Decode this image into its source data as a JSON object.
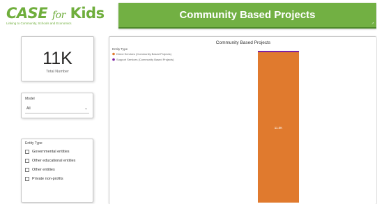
{
  "logo": {
    "main_case": "CASE",
    "main_for": "for",
    "main_kids": "Kids",
    "tagline": "Linking to Community, Schools and Economics"
  },
  "banner": {
    "title": "Community Based Projects",
    "mark": "↗"
  },
  "kpi": {
    "value": "11K",
    "label": "Total Number"
  },
  "model_slicer": {
    "title": "Model",
    "selected": "All",
    "chevron_icon": "chevron-down-icon"
  },
  "entity_slicer": {
    "title": "Entity Type",
    "items": [
      {
        "label": "Governmental entities",
        "checked": false
      },
      {
        "label": "Other educational entities",
        "checked": false
      },
      {
        "label": "Other entities",
        "checked": false
      },
      {
        "label": "Private non-profits",
        "checked": false
      }
    ]
  },
  "colors": {
    "brand_green": "#72b043",
    "orange": "#e07a2e",
    "purple": "#7a1fa2"
  },
  "chart_data": {
    "type": "bar",
    "title": "Community Based Projects",
    "legend_title": "Entity Type",
    "legend_position": "top-left",
    "categories": [
      ""
    ],
    "series": [
      {
        "name": "Direct Services (Community Based Projects)",
        "values": [
          11000
        ],
        "data_label": "11.0K",
        "color": "#e07a2e"
      },
      {
        "name": "Support Services (Community Based Projects)",
        "values": [
          100
        ],
        "data_label": "",
        "color": "#7a1fa2"
      }
    ],
    "stacked": true,
    "ylim": [
      0,
      11100
    ],
    "grid": false,
    "xlabel": "",
    "ylabel": ""
  }
}
